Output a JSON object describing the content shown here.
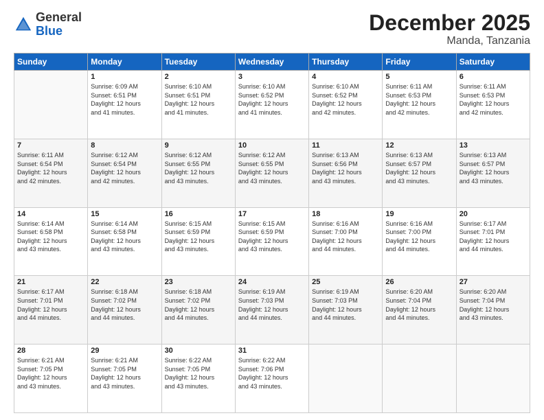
{
  "header": {
    "logo_general": "General",
    "logo_blue": "Blue",
    "main_title": "December 2025",
    "sub_title": "Manda, Tanzania"
  },
  "calendar": {
    "days_of_week": [
      "Sunday",
      "Monday",
      "Tuesday",
      "Wednesday",
      "Thursday",
      "Friday",
      "Saturday"
    ],
    "weeks": [
      [
        {
          "day": "",
          "info": ""
        },
        {
          "day": "1",
          "info": "Sunrise: 6:09 AM\nSunset: 6:51 PM\nDaylight: 12 hours\nand 41 minutes."
        },
        {
          "day": "2",
          "info": "Sunrise: 6:10 AM\nSunset: 6:51 PM\nDaylight: 12 hours\nand 41 minutes."
        },
        {
          "day": "3",
          "info": "Sunrise: 6:10 AM\nSunset: 6:52 PM\nDaylight: 12 hours\nand 41 minutes."
        },
        {
          "day": "4",
          "info": "Sunrise: 6:10 AM\nSunset: 6:52 PM\nDaylight: 12 hours\nand 42 minutes."
        },
        {
          "day": "5",
          "info": "Sunrise: 6:11 AM\nSunset: 6:53 PM\nDaylight: 12 hours\nand 42 minutes."
        },
        {
          "day": "6",
          "info": "Sunrise: 6:11 AM\nSunset: 6:53 PM\nDaylight: 12 hours\nand 42 minutes."
        }
      ],
      [
        {
          "day": "7",
          "info": "Sunrise: 6:11 AM\nSunset: 6:54 PM\nDaylight: 12 hours\nand 42 minutes."
        },
        {
          "day": "8",
          "info": "Sunrise: 6:12 AM\nSunset: 6:54 PM\nDaylight: 12 hours\nand 42 minutes."
        },
        {
          "day": "9",
          "info": "Sunrise: 6:12 AM\nSunset: 6:55 PM\nDaylight: 12 hours\nand 43 minutes."
        },
        {
          "day": "10",
          "info": "Sunrise: 6:12 AM\nSunset: 6:55 PM\nDaylight: 12 hours\nand 43 minutes."
        },
        {
          "day": "11",
          "info": "Sunrise: 6:13 AM\nSunset: 6:56 PM\nDaylight: 12 hours\nand 43 minutes."
        },
        {
          "day": "12",
          "info": "Sunrise: 6:13 AM\nSunset: 6:57 PM\nDaylight: 12 hours\nand 43 minutes."
        },
        {
          "day": "13",
          "info": "Sunrise: 6:13 AM\nSunset: 6:57 PM\nDaylight: 12 hours\nand 43 minutes."
        }
      ],
      [
        {
          "day": "14",
          "info": "Sunrise: 6:14 AM\nSunset: 6:58 PM\nDaylight: 12 hours\nand 43 minutes."
        },
        {
          "day": "15",
          "info": "Sunrise: 6:14 AM\nSunset: 6:58 PM\nDaylight: 12 hours\nand 43 minutes."
        },
        {
          "day": "16",
          "info": "Sunrise: 6:15 AM\nSunset: 6:59 PM\nDaylight: 12 hours\nand 43 minutes."
        },
        {
          "day": "17",
          "info": "Sunrise: 6:15 AM\nSunset: 6:59 PM\nDaylight: 12 hours\nand 43 minutes."
        },
        {
          "day": "18",
          "info": "Sunrise: 6:16 AM\nSunset: 7:00 PM\nDaylight: 12 hours\nand 44 minutes."
        },
        {
          "day": "19",
          "info": "Sunrise: 6:16 AM\nSunset: 7:00 PM\nDaylight: 12 hours\nand 44 minutes."
        },
        {
          "day": "20",
          "info": "Sunrise: 6:17 AM\nSunset: 7:01 PM\nDaylight: 12 hours\nand 44 minutes."
        }
      ],
      [
        {
          "day": "21",
          "info": "Sunrise: 6:17 AM\nSunset: 7:01 PM\nDaylight: 12 hours\nand 44 minutes."
        },
        {
          "day": "22",
          "info": "Sunrise: 6:18 AM\nSunset: 7:02 PM\nDaylight: 12 hours\nand 44 minutes."
        },
        {
          "day": "23",
          "info": "Sunrise: 6:18 AM\nSunset: 7:02 PM\nDaylight: 12 hours\nand 44 minutes."
        },
        {
          "day": "24",
          "info": "Sunrise: 6:19 AM\nSunset: 7:03 PM\nDaylight: 12 hours\nand 44 minutes."
        },
        {
          "day": "25",
          "info": "Sunrise: 6:19 AM\nSunset: 7:03 PM\nDaylight: 12 hours\nand 44 minutes."
        },
        {
          "day": "26",
          "info": "Sunrise: 6:20 AM\nSunset: 7:04 PM\nDaylight: 12 hours\nand 44 minutes."
        },
        {
          "day": "27",
          "info": "Sunrise: 6:20 AM\nSunset: 7:04 PM\nDaylight: 12 hours\nand 43 minutes."
        }
      ],
      [
        {
          "day": "28",
          "info": "Sunrise: 6:21 AM\nSunset: 7:05 PM\nDaylight: 12 hours\nand 43 minutes."
        },
        {
          "day": "29",
          "info": "Sunrise: 6:21 AM\nSunset: 7:05 PM\nDaylight: 12 hours\nand 43 minutes."
        },
        {
          "day": "30",
          "info": "Sunrise: 6:22 AM\nSunset: 7:05 PM\nDaylight: 12 hours\nand 43 minutes."
        },
        {
          "day": "31",
          "info": "Sunrise: 6:22 AM\nSunset: 7:06 PM\nDaylight: 12 hours\nand 43 minutes."
        },
        {
          "day": "",
          "info": ""
        },
        {
          "day": "",
          "info": ""
        },
        {
          "day": "",
          "info": ""
        }
      ]
    ]
  }
}
